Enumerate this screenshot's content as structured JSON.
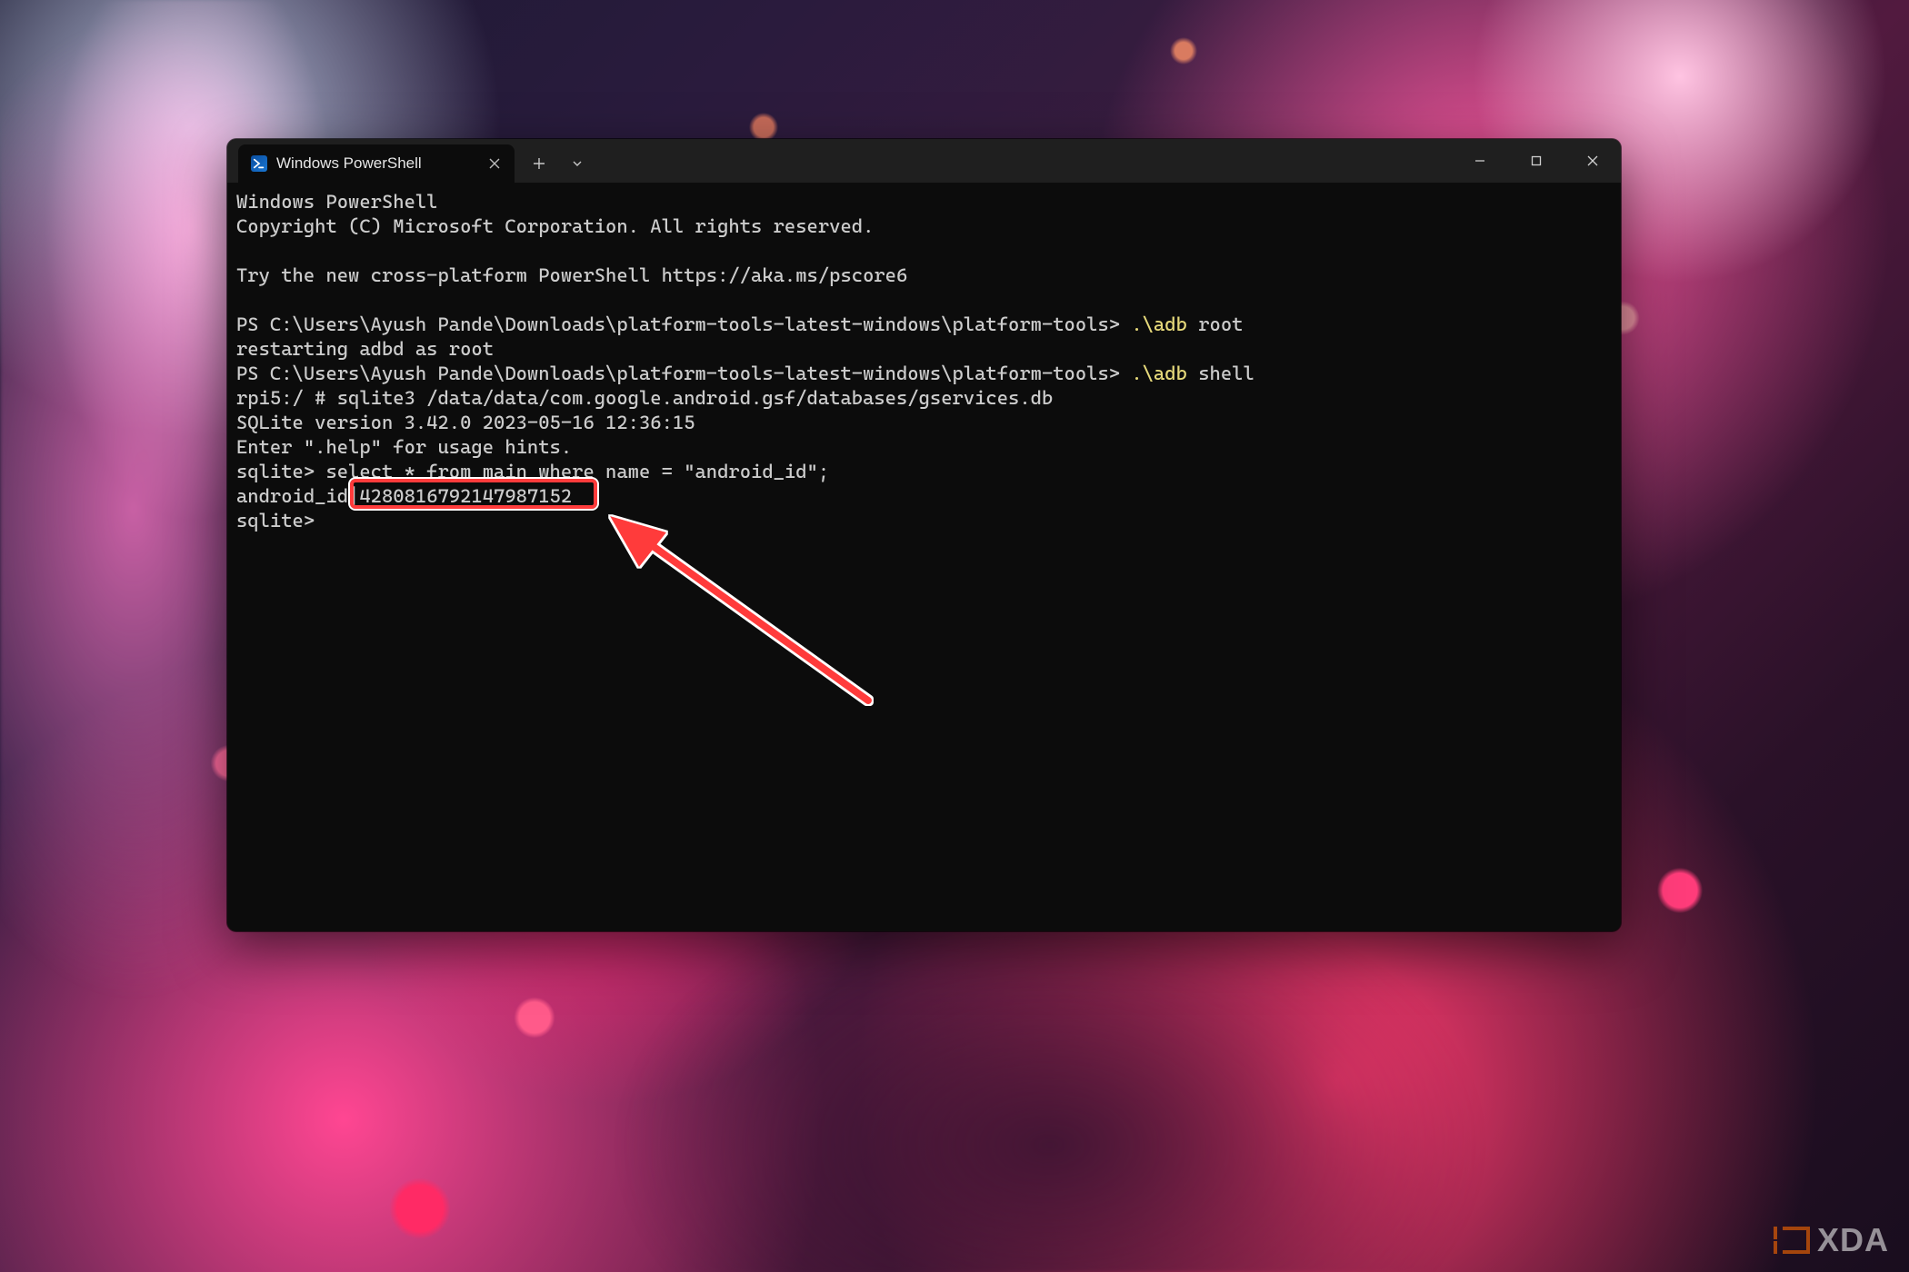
{
  "window": {
    "tab_title": "Windows PowerShell",
    "tab_icon_glyph": ">_"
  },
  "terminal": {
    "line01": "Windows PowerShell",
    "line02": "Copyright (C) Microsoft Corporation. All rights reserved.",
    "line03": "",
    "line04": "Try the new cross-platform PowerShell https://aka.ms/pscore6",
    "line05": "",
    "prompt1_pre": "PS C:\\Users\\Ayush Pande\\Downloads\\platform-tools-latest-windows\\platform-tools> ",
    "cmd1_part1": ".",
    "cmd1_part2": "\\adb ",
    "cmd1_part3": "root",
    "line07": "restarting adbd as root",
    "prompt2_pre": "PS C:\\Users\\Ayush Pande\\Downloads\\platform-tools-latest-windows\\platform-tools> ",
    "cmd2_part1": ".",
    "cmd2_part2": "\\adb ",
    "cmd2_part3": "shell",
    "line09": "rpi5:/ # sqlite3 /data/data/com.google.android.gsf/databases/gservices.db",
    "line10": "SQLite version 3.42.0 2023-05-16 12:36:15",
    "line11": "Enter \".help\" for usage hints.",
    "line12": "sqlite> select * from main where name = \"android_id\";",
    "line13_key": "android_id|",
    "line13_val": "4280816792147987152",
    "line14": "sqlite>"
  },
  "watermark": {
    "text": "XDA"
  },
  "annotation": {
    "highlight_target": "android_id value 4280816792147987152"
  }
}
